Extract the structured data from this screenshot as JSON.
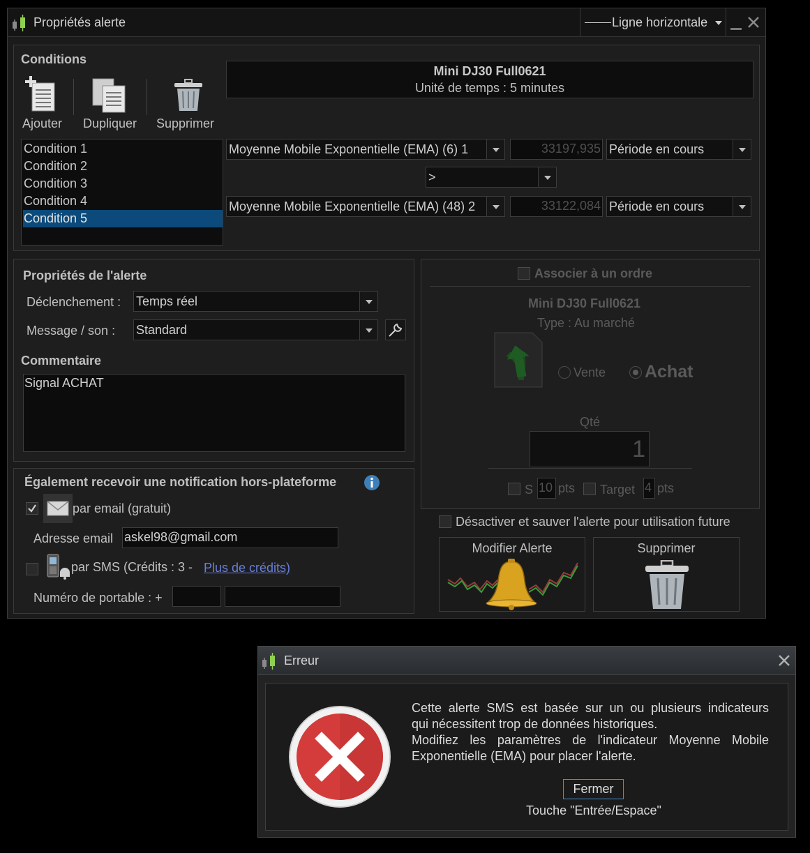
{
  "main_window": {
    "title": "Propriétés alerte",
    "drawing_tool": "Ligne horizontale"
  },
  "conditions": {
    "header": "Conditions",
    "toolbar": {
      "add": "Ajouter",
      "duplicate": "Dupliquer",
      "delete": "Supprimer"
    },
    "instrument": "Mini DJ30 Full0621",
    "timeframe": "Unité de temps : 5 minutes",
    "list": [
      "Condition 1",
      "Condition 2",
      "Condition 3",
      "Condition 4",
      "Condition 5"
    ],
    "selected_index": 4,
    "row1": {
      "indicator": "Moyenne Mobile Exponentielle (EMA) (6) 1",
      "value": "33197,935",
      "period": "Période en cours"
    },
    "operator": ">",
    "row2": {
      "indicator": "Moyenne Mobile Exponentielle (EMA) (48) 2",
      "value": "33122,084",
      "period": "Période en cours"
    }
  },
  "alert_props": {
    "header": "Propriétés de l'alerte",
    "trigger_label": "Déclenchement :",
    "trigger_value": "Temps réel",
    "message_label": "Message / son :",
    "message_value": "Standard",
    "comment_header": "Commentaire",
    "comment_value": "Signal ACHAT"
  },
  "notification": {
    "header": "Également recevoir une notification hors-plateforme",
    "email_label": "par email (gratuit)",
    "email_checked": true,
    "address_label": "Adresse email",
    "address_value": "askel98@gmail.com",
    "sms_label": "par SMS (Crédits : 3 -",
    "sms_link": "Plus de crédits)",
    "sms_checked": false,
    "phone_label": "Numéro de portable : +"
  },
  "order": {
    "header": "Associer à un ordre",
    "instrument": "Mini DJ30 Full0621",
    "type": "Type : Au marché",
    "sell_label": "Vente",
    "buy_label": "Achat",
    "qty_label": "Qté",
    "qty_value": "1",
    "stop_label": "S",
    "stop_value": "10",
    "stop_unit": "pts",
    "target_label": "Target",
    "target_value": "4",
    "target_unit": "pts"
  },
  "deactivate_label": "Désactiver et sauver l'alerte pour utilisation future",
  "modify_button": "Modifier Alerte",
  "delete_button": "Supprimer",
  "error_dialog": {
    "title": "Erreur",
    "line1": "Cette alerte SMS est basée sur un ou plusieurs indicateurs",
    "line2": "qui nécessitent trop de données historiques.",
    "line3": "Modifiez les paramètres de l'indicateur Moyenne Mobile",
    "line4": "Exponentielle (EMA) pour placer l'alerte.",
    "close_button": "Fermer",
    "hint": "Touche \"Entrée/Espace\""
  },
  "colors": {
    "selection": "#0b4a7a",
    "link": "#6a7fd8",
    "error_red": "#d43c3c",
    "accent_green": "#8fd14f"
  }
}
